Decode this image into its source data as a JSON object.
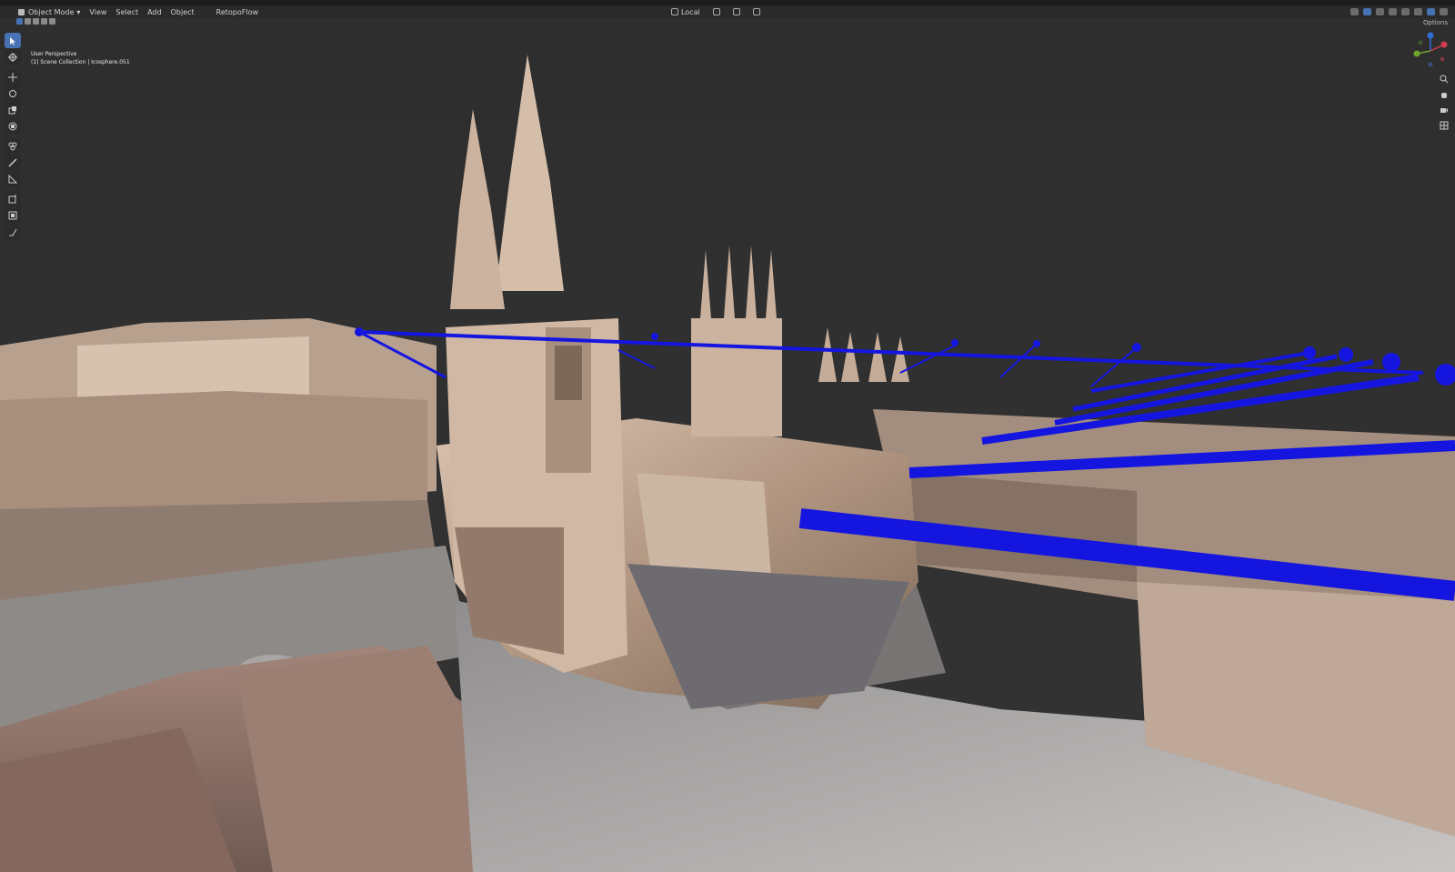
{
  "header": {
    "mode_label": "Object Mode",
    "menus": [
      "View",
      "Select",
      "Add",
      "Object"
    ],
    "addon_label": "RetopoFlow",
    "transform_orientation": "Local",
    "options_label": "Options"
  },
  "viewport": {
    "view_name": "User Perspective",
    "collection_path": "(1) Scene Collection | Icosphere.051"
  },
  "toolbar": {
    "tools": [
      "select-box",
      "cursor",
      "move",
      "rotate",
      "scale",
      "transform",
      "annotate",
      "measure",
      "add-cube",
      "extra-tool",
      "extra-tool-2"
    ]
  },
  "colors": {
    "accent": "#4772b3",
    "camera_path": "#1515e0",
    "background": "#2f2f2f"
  }
}
